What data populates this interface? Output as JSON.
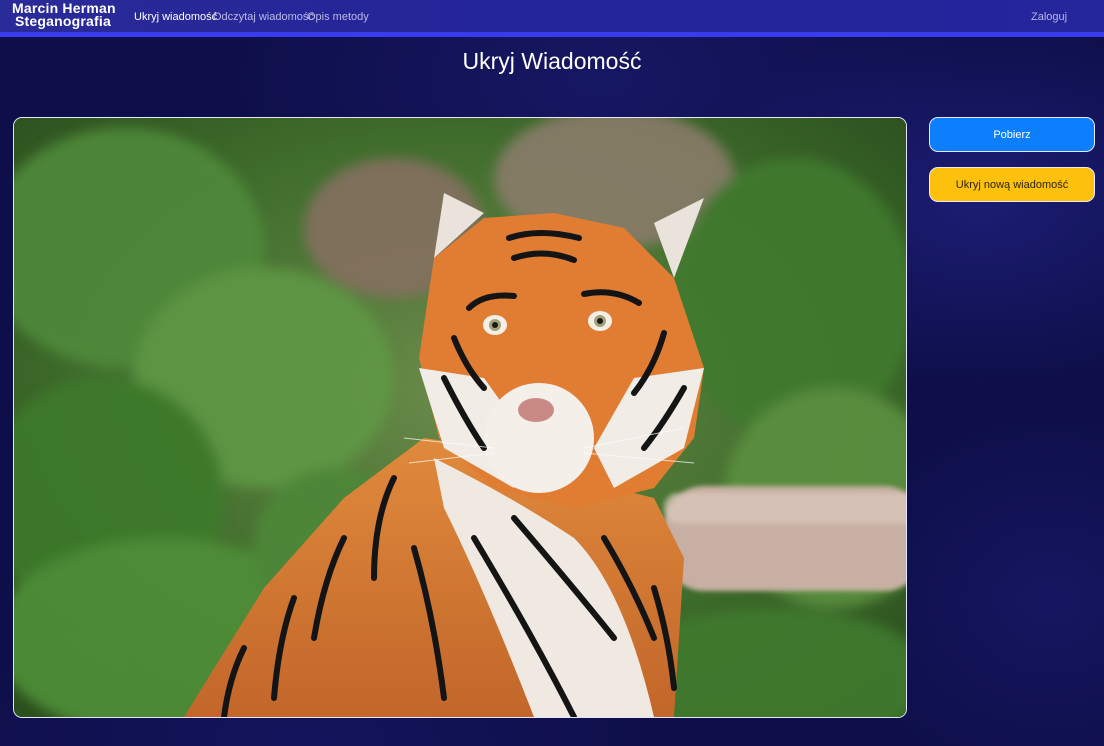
{
  "navbar": {
    "brand_line1": "Marcin Herman",
    "brand_line2": "Steganografia",
    "links": [
      {
        "label": "Ukryj wiadomość",
        "active": true
      },
      {
        "label": "Odczytaj wiadomość",
        "active": false
      },
      {
        "label": "Opis metody",
        "active": false
      }
    ],
    "login_label": "Zaloguj"
  },
  "main": {
    "title": "Ukryj Wiadomość",
    "image": {
      "subject": "tiger-photo"
    }
  },
  "actions": {
    "download_label": "Pobierz",
    "hide_new_label": "Ukryj nową wiadomość"
  },
  "colors": {
    "navbar": "#2a2a98",
    "navbar_border": "#3a3aee",
    "page_bg": "#0e0f4a",
    "primary": "#0d7efc",
    "warning": "#fdc10d"
  }
}
